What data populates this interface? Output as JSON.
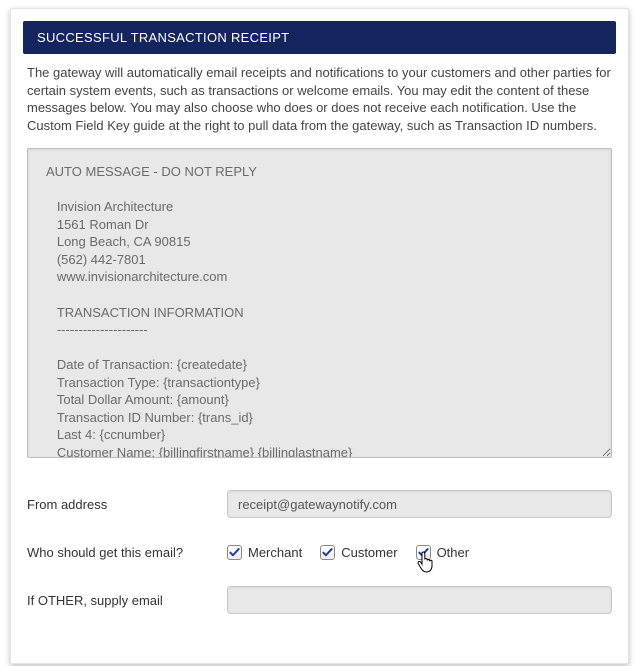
{
  "header": {
    "title": "SUCCESSFUL TRANSACTION RECEIPT"
  },
  "description": "The gateway will automatically email receipts and notifications to your customers and other parties for certain system events, such as transactions or welcome emails. You may edit the content of these messages below. You may also choose who does or does not receive each notification. Use the Custom Field Key guide at the right to pull data from the gateway, such as Transaction ID numbers.",
  "message_body": "AUTO MESSAGE - DO NOT REPLY\n\n   Invision Architecture\n   1561 Roman Dr\n   Long Beach, CA 90815\n   (562) 442-7801\n   www.invisionarchitecture.com\n\n   TRANSACTION INFORMATION\n   ---------------------\n\n   Date of Transaction: {createdate}\n   Transaction Type: {transactiontype}\n   Total Dollar Amount: {amount}\n   Transaction ID Number: {trans_id}\n   Last 4: {ccnumber}\n   Customer Name: {billingfirstname} {billinglastname}",
  "form": {
    "from_label": "From address",
    "from_value": "receipt@gatewaynotify.com",
    "recipients_label": "Who should get this email?",
    "checkboxes": {
      "merchant": {
        "label": "Merchant",
        "checked": true
      },
      "customer": {
        "label": "Customer",
        "checked": true
      },
      "other": {
        "label": "Other",
        "checked": true
      }
    },
    "other_email_label": "If OTHER, supply email",
    "other_email_value": ""
  },
  "colors": {
    "header_bg": "#14245e",
    "check": "#1f3fa8"
  }
}
